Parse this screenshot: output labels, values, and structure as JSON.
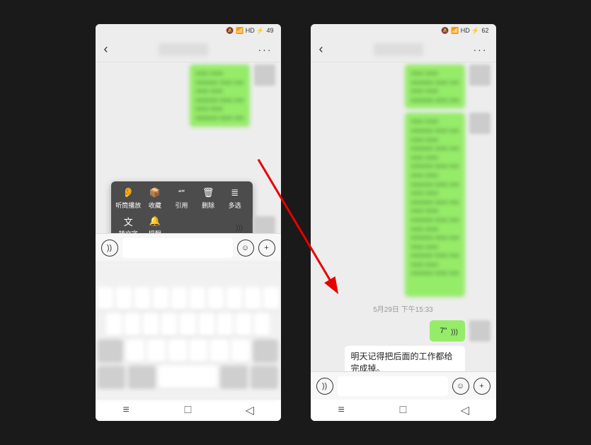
{
  "status": {
    "icons": "🔕 📶 HD ⚡",
    "battery_left": "49",
    "battery_right": "62"
  },
  "topbar": {
    "back_glyph": "‹",
    "more_glyph": "···"
  },
  "context_menu": {
    "items": [
      {
        "icon": "👂",
        "label": "听筒播放"
      },
      {
        "icon": "📦",
        "label": "收藏"
      },
      {
        "icon": "“”",
        "label": "引用"
      },
      {
        "icon": "🗑",
        "label": "删除"
      },
      {
        "icon": "≣",
        "label": "多选"
      },
      {
        "icon": "文",
        "label": "转文字"
      },
      {
        "icon": "🔔",
        "label": "提醒"
      }
    ]
  },
  "voice": {
    "duration_label": "7\""
  },
  "timestamp_text": "5月29日 下午15:33",
  "transcription_text": "明天记得把后面的工作都给完成掉。",
  "inputbar": {
    "voice_glyph": "))",
    "emoji_glyph": "☺",
    "plus_glyph": "+"
  },
  "nav": {
    "menu_glyph": "≡",
    "home_glyph": "□",
    "back_glyph": "◁"
  }
}
